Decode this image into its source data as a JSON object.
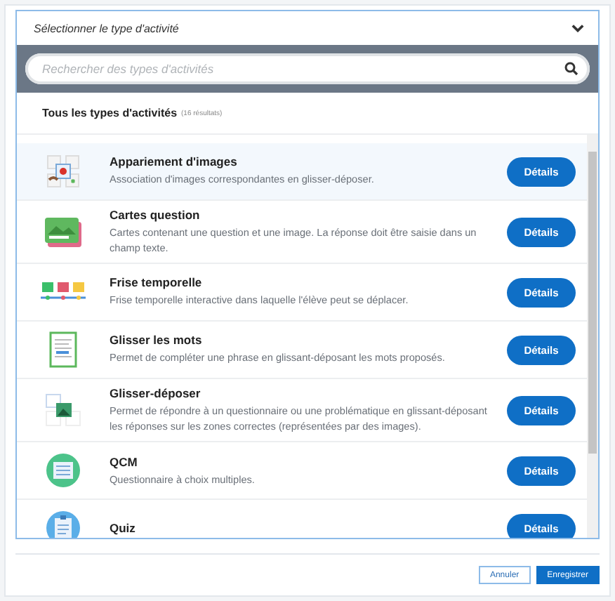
{
  "panel": {
    "title": "Sélectionner le type d'activité",
    "expanded": true
  },
  "search": {
    "placeholder": "Rechercher des types d'activités"
  },
  "heading": {
    "title": "Tous les types d'activités",
    "count": "(16 résultats)"
  },
  "activities": [
    {
      "kind": "pairing",
      "title": "Appariement d'images",
      "description": "Association d'images correspondantes en glisser-déposer.",
      "button": "Détails",
      "selected": true
    },
    {
      "kind": "cards",
      "title": "Cartes question",
      "description": "Cartes contenant une question et une image. La réponse doit être saisie dans un champ texte.",
      "button": "Détails",
      "selected": false
    },
    {
      "kind": "timeline",
      "title": "Frise temporelle",
      "description": "Frise temporelle interactive dans laquelle l'élève peut se déplacer.",
      "button": "Détails",
      "selected": false
    },
    {
      "kind": "words",
      "title": "Glisser les mots",
      "description": "Permet de compléter une phrase en glissant-déposant les mots proposés.",
      "button": "Détails",
      "selected": false
    },
    {
      "kind": "dragdrop",
      "title": "Glisser-déposer",
      "description": "Permet de répondre à un questionnaire ou une problématique en glissant-déposant les réponses sur les zones correctes (représentées par des images).",
      "button": "Détails",
      "selected": false
    },
    {
      "kind": "mcq",
      "title": "QCM",
      "description": "Questionnaire à choix multiples.",
      "button": "Détails",
      "selected": false
    },
    {
      "kind": "quiz",
      "title": "Quiz",
      "button": "Détails",
      "selected": false
    }
  ],
  "buttons": [
    {
      "kind": "secondary",
      "label": "Annuler"
    },
    {
      "kind": "primary",
      "label": "Enregistrer"
    }
  ]
}
